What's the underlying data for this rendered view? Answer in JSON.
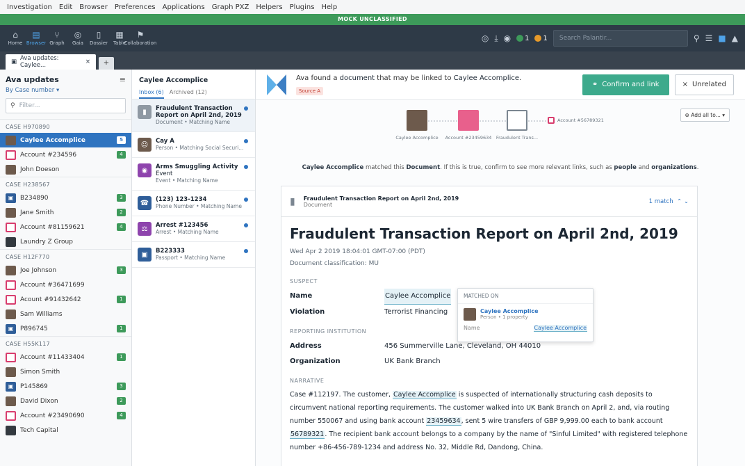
{
  "menu": [
    "Investigation",
    "Edit",
    "Browser",
    "Preferences",
    "Applications",
    "Graph PXZ",
    "Helpers",
    "Plugins",
    "Help"
  ],
  "banner": "MOCK UNCLASSIFIED",
  "toolbar": {
    "buttons": [
      {
        "label": "Home",
        "icon": "home-icon"
      },
      {
        "label": "Browser",
        "icon": "browser-icon"
      },
      {
        "label": "Graph",
        "icon": "graph-icon"
      },
      {
        "label": "Gaia",
        "icon": "gaia-icon"
      },
      {
        "label": "Dossier",
        "icon": "dossier-icon"
      },
      {
        "label": "Table",
        "icon": "table-icon"
      },
      {
        "label": "Collaboration",
        "icon": "collaboration-icon"
      }
    ],
    "search_placeholder": "Search Palantir..."
  },
  "tab": {
    "label": "Ava updates: Caylee..."
  },
  "left": {
    "title": "Ava updates",
    "subtitle": "By Case number ▾",
    "filter_placeholder": "Filter...",
    "cases": [
      {
        "id": "CASE H970890",
        "items": [
          {
            "label": "Caylee Accomplice",
            "type": "person",
            "badge": "5",
            "selected": true
          },
          {
            "label": "Account #234596",
            "type": "acct",
            "badge": "4"
          },
          {
            "label": "John Doeson",
            "type": "person",
            "badge": ""
          }
        ]
      },
      {
        "id": "CASE H238567",
        "items": [
          {
            "label": "B234890",
            "type": "pass",
            "badge": "3"
          },
          {
            "label": "Jane Smith",
            "type": "person",
            "badge": "2"
          },
          {
            "label": "Account #81159621",
            "type": "acct",
            "badge": "4"
          },
          {
            "label": "Laundry Z Group",
            "type": "group",
            "badge": ""
          }
        ]
      },
      {
        "id": "CASE H12F770",
        "items": [
          {
            "label": "Joe Johnson",
            "type": "person",
            "badge": "3"
          },
          {
            "label": "Account #36471699",
            "type": "acct",
            "badge": ""
          },
          {
            "label": "Acount #91432642",
            "type": "acct",
            "badge": "1"
          },
          {
            "label": "Sam Williams",
            "type": "person",
            "badge": ""
          },
          {
            "label": "P896745",
            "type": "pass",
            "badge": "1"
          }
        ]
      },
      {
        "id": "CASE H55K117",
        "items": [
          {
            "label": "Account #11433404",
            "type": "acct",
            "badge": "1"
          },
          {
            "label": "Simon Smith",
            "type": "person",
            "badge": ""
          },
          {
            "label": "P145869",
            "type": "pass",
            "badge": "3"
          },
          {
            "label": "David Dixon",
            "type": "person",
            "badge": "2"
          },
          {
            "label": "Account #23490690",
            "type": "acct",
            "badge": "4"
          },
          {
            "label": "Tech Capital",
            "type": "group",
            "badge": ""
          }
        ]
      }
    ]
  },
  "mid": {
    "title": "Caylee Accomplice",
    "tab_inbox": "Inbox (6)",
    "tab_archived": "Archived (12)",
    "items": [
      {
        "name": "Fraudulent Transaction Report on April 2nd, 2019",
        "desc": "Document • Matching Name",
        "color": "#8f99a3",
        "icon": "document-icon",
        "selected": true
      },
      {
        "name": "Cay A",
        "desc": "Person • Matching Social Securi...",
        "color": "#6d5a4c",
        "icon": "person-icon"
      },
      {
        "name": "Arms Smuggling Activity",
        "sub": "Event",
        "desc": "Event • Matching Name",
        "color": "#8e44ad",
        "icon": "event-icon"
      },
      {
        "name": "(123) 123-1234",
        "desc": "Phone Number • Matching Name",
        "color": "#2f5e99",
        "icon": "phone-icon"
      },
      {
        "name": "Arrest #123456",
        "desc": "Arrest • Matching Name",
        "color": "#8e44ad",
        "icon": "arrest-icon"
      },
      {
        "name": "B223333",
        "desc": "Passport • Matching Name",
        "color": "#2f5e99",
        "icon": "passport-icon"
      }
    ]
  },
  "header": {
    "prefix": "Ava found a",
    "doc": "document",
    "mid": "that may be linked to",
    "entity": "Caylee Accomplice",
    "source": "Source A",
    "confirm": "Confirm and link",
    "unrelated": "Unrelated"
  },
  "graph": {
    "nodes": [
      "Caylee Accomplice",
      "Account #23459634",
      "Fraudulent Trans...",
      "Account #56789321"
    ],
    "add_all": "Add all to...",
    "sentence_a": "Caylee Accomplice",
    "sentence_b": "matched this",
    "sentence_c": "Document",
    "sentence_d": ". If this is true, confirm to see more relevant links, such as",
    "sentence_e": "people",
    "sentence_f": "and",
    "sentence_g": "organizations",
    "sentence_h": "."
  },
  "doc": {
    "header_title": "Fraudulent Transaction Report on April 2nd, 2019",
    "header_type": "Document",
    "match": "1 match",
    "title": "Fraudulent Transaction Report on April 2nd, 2019",
    "date": "Wed Apr 2 2019 18:04:01 GMT-07:00 (PDT)",
    "classification": "Document classification: MU",
    "suspect_label": "SUSPECT",
    "name_k": "Name",
    "name_v": "Caylee Accomplice",
    "viol_k": "Violation",
    "viol_v": "Terrorist Financing",
    "inst_label": "REPORTING INSTITUTION",
    "addr_k": "Address",
    "addr_v": "456 Summerville Lane, Cleveland, OH 44010",
    "org_k": "Organization",
    "org_v": "UK Bank Branch",
    "narr_label": "NARRATIVE",
    "n1": "Case #112197. The customer,",
    "n2": "Caylee Accomplice",
    "n3": "is suspected of internationally structuring cash deposits to circumvent national reporting requirements. The customer walked into UK Bank Branch on April 2, and, via routing number 550067 and using bank account",
    "n4": "23459634",
    "n5": ", sent 5 wire transfers of GBP 9,999.00 each to bank account",
    "n6": "56789321",
    "n7": ". The recipient bank account belongs to a company by the name of \"Sinful Limited\" with registered telephone number +86-456-789-1234 and address No. 32, Middle Rd, Dandong, China."
  },
  "popover": {
    "title": "MATCHED ON",
    "name": "Caylee Accomplice",
    "desc": "Person • 1 property",
    "field": "Name",
    "value": "Caylee Accomplice"
  }
}
